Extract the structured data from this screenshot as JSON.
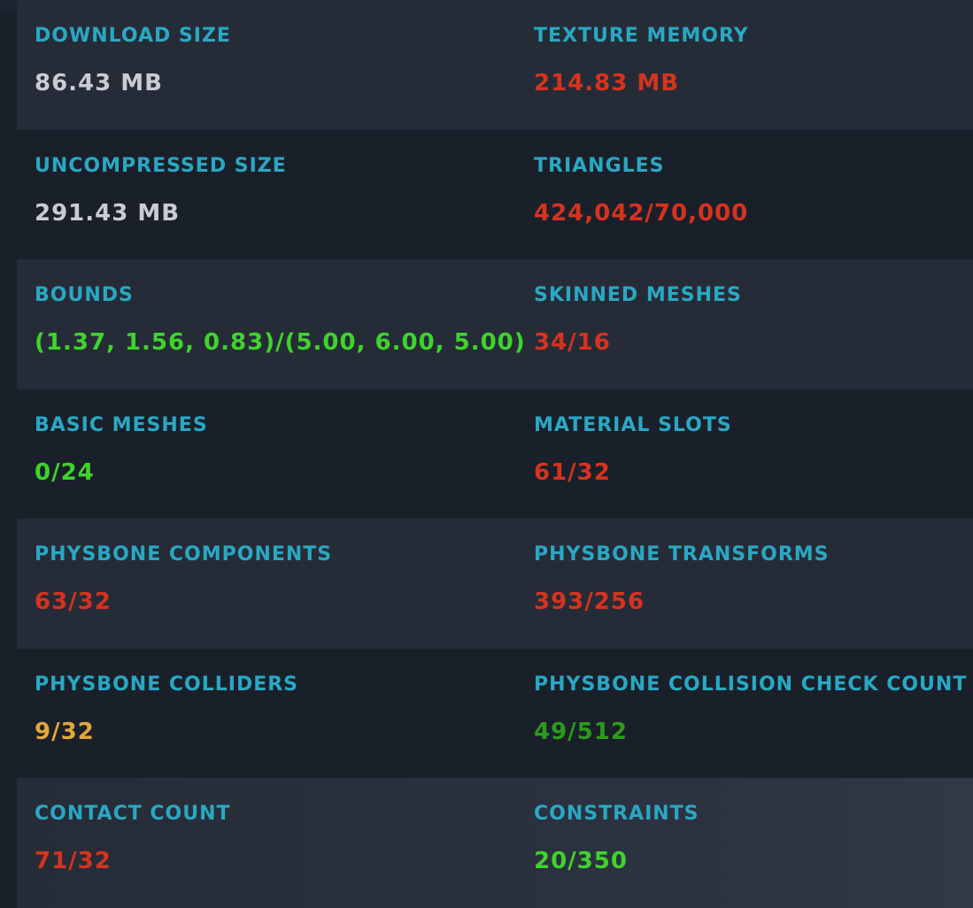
{
  "colors": {
    "label": "#29a8c4",
    "neutral": "#c9ccd2",
    "red": "#d6331e",
    "green": "#3ed42b",
    "darkgreen": "#2d9a1c",
    "yellow": "#e2a83b"
  },
  "rows": [
    {
      "left": {
        "label": "DOWNLOAD SIZE",
        "value": "86.43 MB",
        "status": "neutral"
      },
      "right": {
        "label": "TEXTURE MEMORY",
        "value": "214.83 MB",
        "status": "red"
      }
    },
    {
      "left": {
        "label": "UNCOMPRESSED SIZE",
        "value": "291.43 MB",
        "status": "neutral"
      },
      "right": {
        "label": "TRIANGLES",
        "value": "424,042/70,000",
        "status": "red"
      }
    },
    {
      "left": {
        "label": "BOUNDS",
        "value": "(1.37, 1.56, 0.83)/(5.00, 6.00, 5.00)",
        "status": "green"
      },
      "right": {
        "label": "SKINNED MESHES",
        "value": "34/16",
        "status": "red"
      }
    },
    {
      "left": {
        "label": "BASIC MESHES",
        "value": "0/24",
        "status": "green"
      },
      "right": {
        "label": "MATERIAL SLOTS",
        "value": "61/32",
        "status": "red"
      }
    },
    {
      "left": {
        "label": "PHYSBONE COMPONENTS",
        "value": "63/32",
        "status": "red"
      },
      "right": {
        "label": "PHYSBONE TRANSFORMS",
        "value": "393/256",
        "status": "red"
      }
    },
    {
      "left": {
        "label": "PHYSBONE COLLIDERS",
        "value": "9/32",
        "status": "yellow"
      },
      "right": {
        "label": "PHYSBONE COLLISION CHECK COUNT",
        "value": "49/512",
        "status": "darkgreen"
      }
    },
    {
      "left": {
        "label": "CONTACT COUNT",
        "value": "71/32",
        "status": "red"
      },
      "right": {
        "label": "CONSTRAINTS",
        "value": "20/350",
        "status": "green"
      }
    }
  ]
}
